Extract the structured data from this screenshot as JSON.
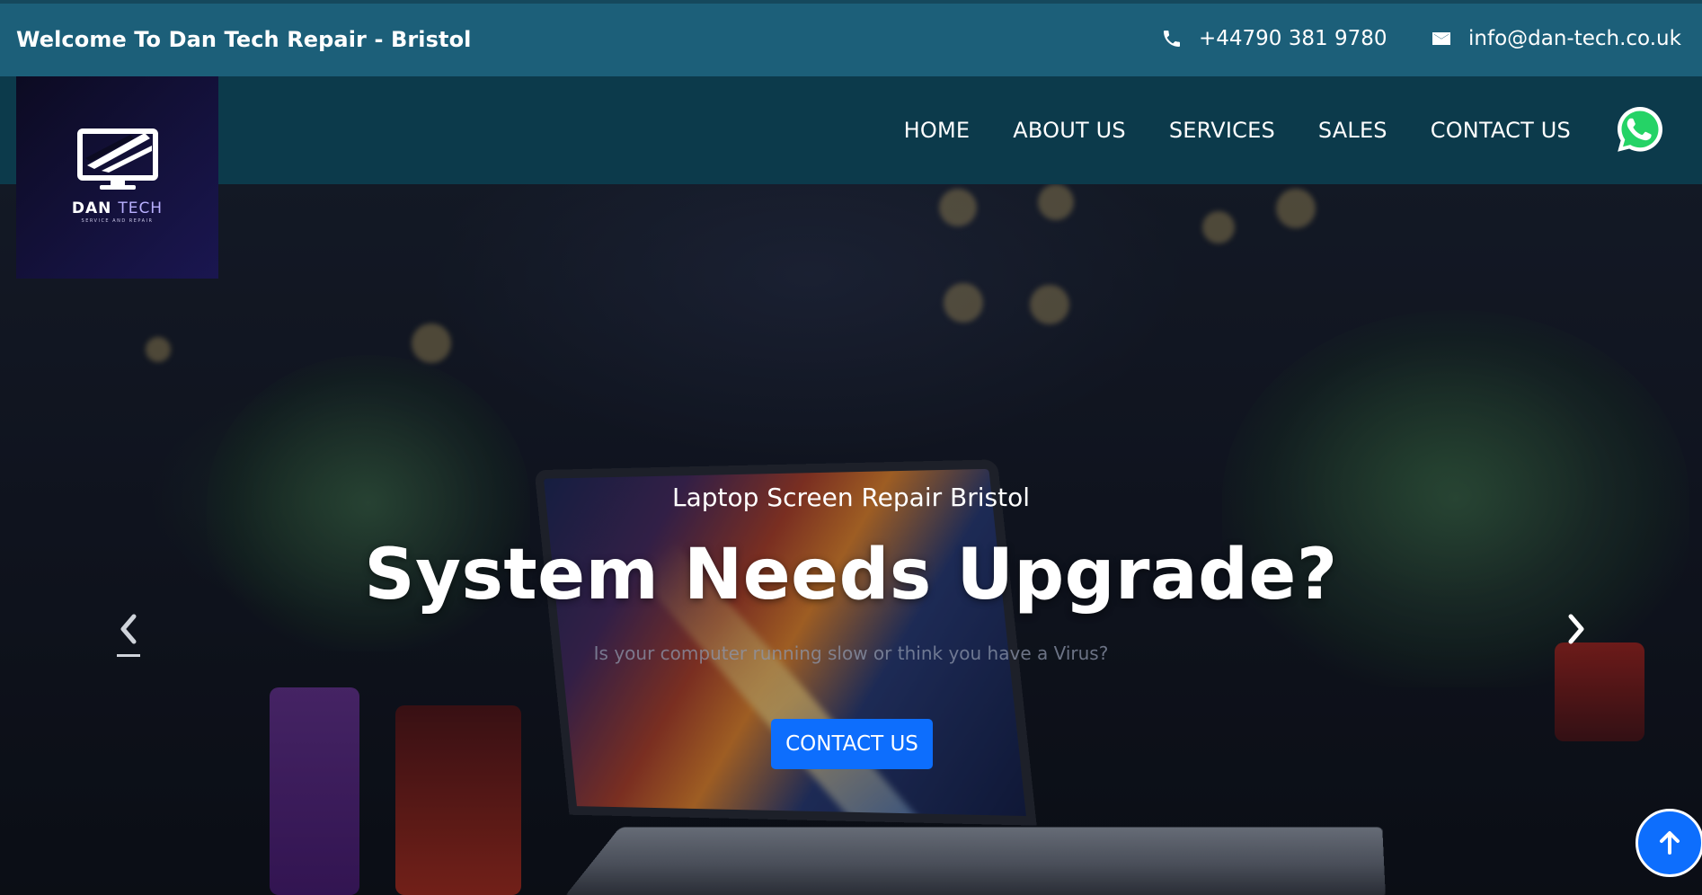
{
  "topbar": {
    "welcome": "Welcome To Dan Tech Repair - Bristol",
    "phone": "+44790 381 9780",
    "email": "info@dan-tech.co.uk",
    "phone_icon": "phone-icon",
    "email_icon": "envelope-icon"
  },
  "logo": {
    "brand_dan": "DAN",
    "brand_tech": "TECH",
    "tagline": "SERVICE AND REPAIR"
  },
  "nav": {
    "items": [
      "HOME",
      "ABOUT US",
      "SERVICES",
      "SALES",
      "CONTACT US"
    ],
    "whatsapp_icon": "whatsapp-icon"
  },
  "hero": {
    "subtitle": "Laptop Screen Repair Bristol",
    "title": "System Needs Upgrade?",
    "description": "Is your computer running slow or think you have a Virus?",
    "cta": "CONTACT US",
    "prev_icon": "chevron-left-icon",
    "next_icon": "chevron-right-icon"
  },
  "scroll_top_icon": "arrow-up-icon",
  "colors": {
    "topbar": "#1c5f79",
    "navbar": "#0c3a4b",
    "accent": "#0d6efd",
    "whatsapp": "#25d366"
  }
}
